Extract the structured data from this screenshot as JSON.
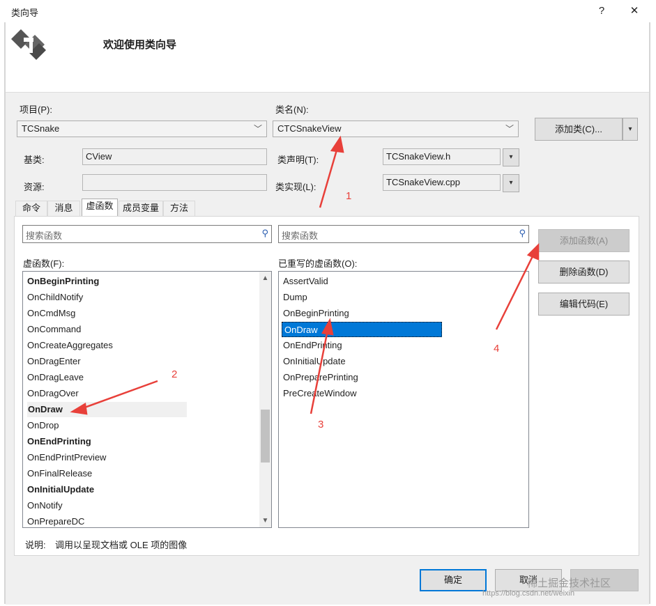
{
  "window": {
    "title": "类向导",
    "help_btn": "?",
    "close_btn": "✕"
  },
  "header": {
    "welcome": "欢迎使用类向导"
  },
  "project": {
    "label": "项目(P):",
    "value": "TCSnake"
  },
  "classname": {
    "label": "类名(N):",
    "value": "CTCSnakeView"
  },
  "add_class_button": "添加类(C)...",
  "base_class": {
    "label": "基类:",
    "value": "CView"
  },
  "resource": {
    "label": "资源:",
    "value": ""
  },
  "class_decl": {
    "label": "类声明(T):",
    "value": "TCSnakeView.h"
  },
  "class_impl": {
    "label": "类实现(L):",
    "value": "TCSnakeView.cpp"
  },
  "tabs": [
    "命令",
    "消息",
    "虚函数",
    "成员变量",
    "方法"
  ],
  "active_tab": "虚函数",
  "search_left": {
    "placeholder": "搜索函数"
  },
  "search_right": {
    "placeholder": "搜索函数"
  },
  "virtual_label": "虚函数(F):",
  "overridden_label": "已重写的虚函数(O):",
  "virtual_functions": [
    {
      "name": "OnBeginPrinting",
      "bold": true
    },
    {
      "name": "OnChildNotify",
      "bold": false
    },
    {
      "name": "OnCmdMsg",
      "bold": false
    },
    {
      "name": "OnCommand",
      "bold": false
    },
    {
      "name": "OnCreateAggregates",
      "bold": false
    },
    {
      "name": "OnDragEnter",
      "bold": false
    },
    {
      "name": "OnDragLeave",
      "bold": false
    },
    {
      "name": "OnDragOver",
      "bold": false
    },
    {
      "name": "OnDraw",
      "bold": true
    },
    {
      "name": "OnDrop",
      "bold": false
    },
    {
      "name": "OnEndPrinting",
      "bold": true
    },
    {
      "name": "OnEndPrintPreview",
      "bold": false
    },
    {
      "name": "OnFinalRelease",
      "bold": false
    },
    {
      "name": "OnInitialUpdate",
      "bold": true
    },
    {
      "name": "OnNotify",
      "bold": false
    },
    {
      "name": "OnPrepareDC",
      "bold": false
    }
  ],
  "overridden_functions": [
    "AssertValid",
    "Dump",
    "OnBeginPrinting",
    "OnDraw",
    "OnEndPrinting",
    "OnInitialUpdate",
    "OnPreparePrinting",
    "PreCreateWindow"
  ],
  "selected_overridden": "OnDraw",
  "buttons": {
    "add_function": "添加函数(A)",
    "delete_function": "删除函数(D)",
    "edit_code": "编辑代码(E)"
  },
  "description": {
    "label": "说明:",
    "text": "调用以呈现文档或 OLE 项的图像"
  },
  "footer": {
    "ok": "确定",
    "cancel": "取消"
  },
  "annotations": [
    "1",
    "2",
    "3",
    "4"
  ],
  "watermark": "稀土掘金技术社区",
  "watermark_url": "https://blog.csdn.net/weixin",
  "colors": {
    "selection": "#0078d7",
    "annotation": "#e8403a"
  }
}
